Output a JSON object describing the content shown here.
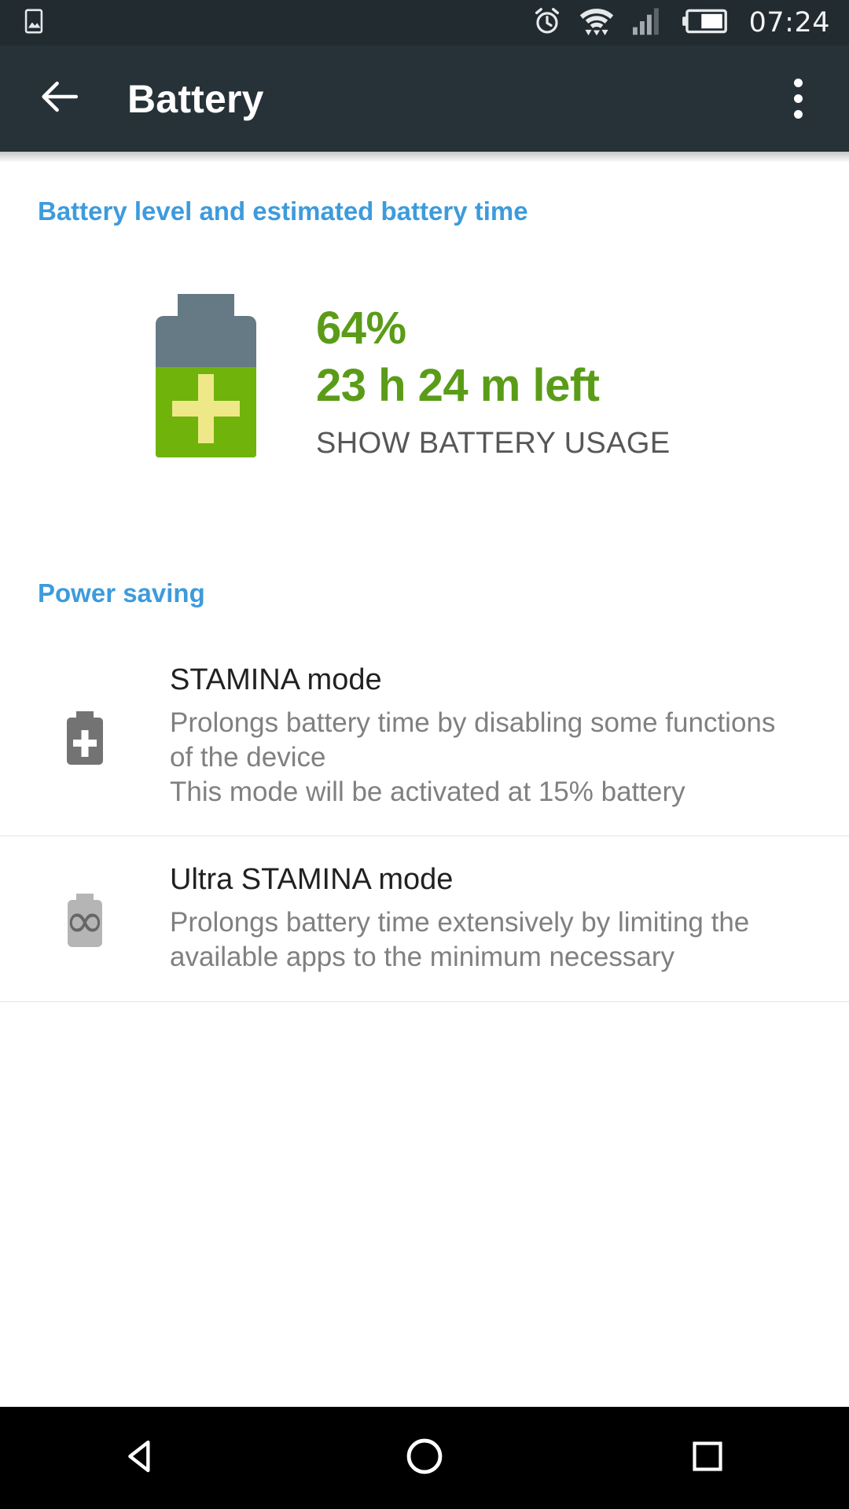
{
  "status_bar": {
    "icons": [
      "photo-icon",
      "alarm-icon",
      "wifi-icon",
      "cellular-signal-icon",
      "battery-icon"
    ],
    "time": "07:24",
    "battery_fill_percent": 64,
    "signal_bars_filled": 3,
    "signal_bars_total": 4,
    "background_color": "#222b30"
  },
  "app_bar": {
    "back_icon": "arrow-left-icon",
    "title": "Battery",
    "overflow_icon": "more-vertical-icon",
    "background_color": "#263238"
  },
  "sections": {
    "battery_level": {
      "header": "Battery level and estimated battery time",
      "header_color": "#3d9bdc",
      "percent": "64%",
      "percent_value": 64,
      "time_left": "23 h 24 m left",
      "action_label": "SHOW BATTERY USAGE",
      "value_color": "#5a9c18",
      "battery_fill_color": "#6fb30b",
      "battery_empty_color": "#657a84",
      "battery_plus_color": "#eee888"
    },
    "power_saving": {
      "header": "Power saving",
      "header_color": "#3d9bdc",
      "items": [
        {
          "icon": "battery-plus-icon",
          "title": "STAMINA mode",
          "description_line1": "Prolongs battery time by disabling some functions",
          "description_line2": "of the device",
          "description_line3": "This mode will be activated at 15% battery"
        },
        {
          "icon": "battery-infinity-icon",
          "title": "Ultra STAMINA mode",
          "description_line1": "Prolongs battery time extensively by limiting the",
          "description_line2": "available apps to the minimum necessary",
          "description_line3": ""
        }
      ]
    }
  },
  "nav_bar": {
    "back": "nav-back-triangle-icon",
    "home": "nav-home-circle-icon",
    "recents": "nav-recents-square-icon",
    "background_color": "#000000"
  }
}
